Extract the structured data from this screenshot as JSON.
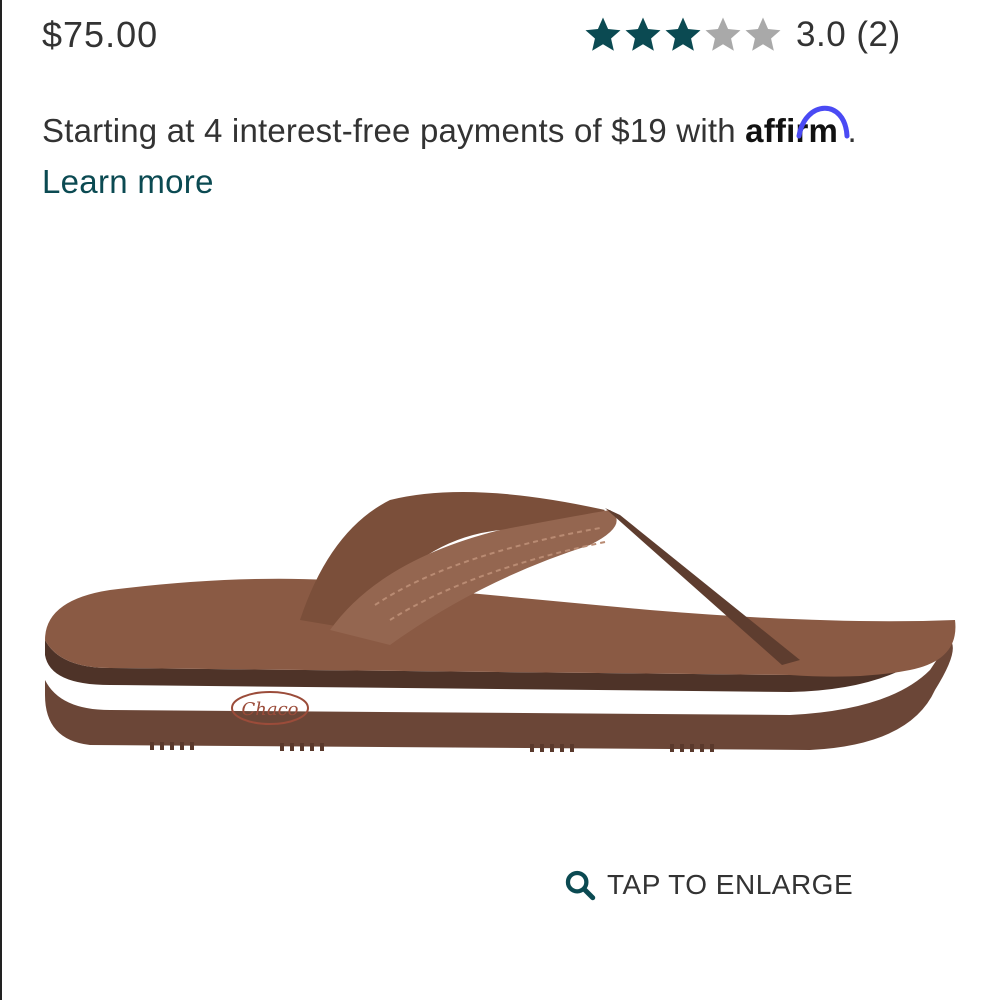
{
  "product": {
    "price": "$75.00",
    "rating_value": 3.0,
    "rating_max": 5,
    "rating_text": "3.0 (2)",
    "image_logo_text": "Chaco"
  },
  "financing": {
    "text": "Starting at 4 interest-free payments of $19 with",
    "brand": "affirm",
    "brand_suffix": ".",
    "learn_more": "Learn more"
  },
  "image_actions": {
    "enlarge_label": "TAP TO ENLARGE",
    "icon": "magnifier-icon"
  },
  "colors": {
    "star_filled": "#0b4a52",
    "star_empty": "#a9a9a9",
    "link": "#0b4a52",
    "affirm_arc": "#4a4af4",
    "sandal": "#7b4f3a"
  }
}
